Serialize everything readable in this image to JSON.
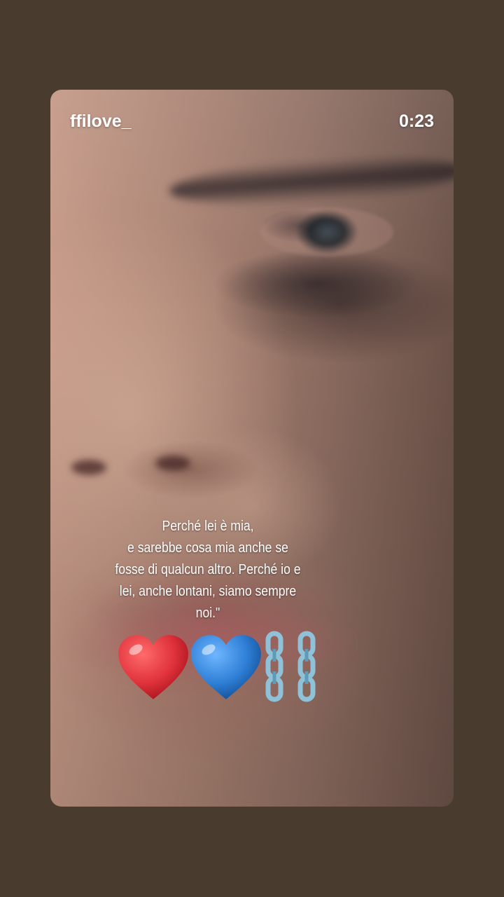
{
  "story": {
    "username": "ffilove_",
    "timestamp": "0:23",
    "caption_lines": [
      "Perché lei è mia,",
      "e sarebbe cosa mia anche se",
      "fosse di qualcun altro. Perché io e",
      "lei, anche lontani, siamo sempre",
      "noi.\""
    ],
    "emojis": [
      "red-heart-emoji",
      "blue-heart-emoji",
      "chains-emoji"
    ],
    "colors": {
      "page_background": "#4a3b2f",
      "text": "#ffffff",
      "red_heart": "#e0323c",
      "blue_heart": "#2e7fd6",
      "chains": "#8fc1d8"
    }
  }
}
